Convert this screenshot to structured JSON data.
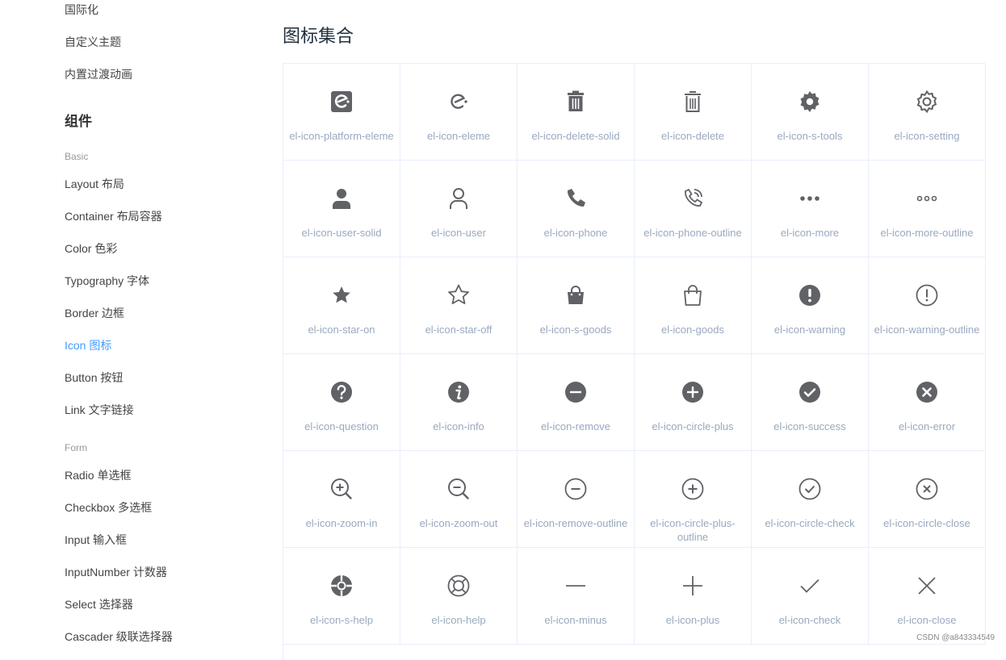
{
  "sidebar": {
    "top_items": [
      "国际化",
      "自定义主题",
      "内置过渡动画"
    ],
    "group_title": "组件",
    "basic": {
      "title": "Basic",
      "items": [
        "Layout 布局",
        "Container 布局容器",
        "Color 色彩",
        "Typography 字体",
        "Border 边框",
        "Icon 图标",
        "Button 按钮",
        "Link 文字链接"
      ]
    },
    "form": {
      "title": "Form",
      "items": [
        "Radio 单选框",
        "Checkbox 多选框",
        "Input 输入框",
        "InputNumber 计数器",
        "Select 选择器",
        "Cascader 级联选择器"
      ]
    },
    "active_item": "Icon 图标"
  },
  "main": {
    "title": "图标集合",
    "icons": [
      {
        "name": "el-icon-platform-eleme",
        "icon": "platform-eleme"
      },
      {
        "name": "el-icon-eleme",
        "icon": "eleme"
      },
      {
        "name": "el-icon-delete-solid",
        "icon": "delete-solid"
      },
      {
        "name": "el-icon-delete",
        "icon": "delete"
      },
      {
        "name": "el-icon-s-tools",
        "icon": "s-tools"
      },
      {
        "name": "el-icon-setting",
        "icon": "setting"
      },
      {
        "name": "el-icon-user-solid",
        "icon": "user-solid"
      },
      {
        "name": "el-icon-user",
        "icon": "user"
      },
      {
        "name": "el-icon-phone",
        "icon": "phone"
      },
      {
        "name": "el-icon-phone-outline",
        "icon": "phone-outline"
      },
      {
        "name": "el-icon-more",
        "icon": "more"
      },
      {
        "name": "el-icon-more-outline",
        "icon": "more-outline"
      },
      {
        "name": "el-icon-star-on",
        "icon": "star-on"
      },
      {
        "name": "el-icon-star-off",
        "icon": "star-off"
      },
      {
        "name": "el-icon-s-goods",
        "icon": "s-goods"
      },
      {
        "name": "el-icon-goods",
        "icon": "goods"
      },
      {
        "name": "el-icon-warning",
        "icon": "warning"
      },
      {
        "name": "el-icon-warning-outline",
        "icon": "warning-outline"
      },
      {
        "name": "el-icon-question",
        "icon": "question"
      },
      {
        "name": "el-icon-info",
        "icon": "info"
      },
      {
        "name": "el-icon-remove",
        "icon": "remove"
      },
      {
        "name": "el-icon-circle-plus",
        "icon": "circle-plus"
      },
      {
        "name": "el-icon-success",
        "icon": "success"
      },
      {
        "name": "el-icon-error",
        "icon": "error"
      },
      {
        "name": "el-icon-zoom-in",
        "icon": "zoom-in"
      },
      {
        "name": "el-icon-zoom-out",
        "icon": "zoom-out"
      },
      {
        "name": "el-icon-remove-outline",
        "icon": "remove-outline"
      },
      {
        "name": "el-icon-circle-plus-outline",
        "icon": "circle-plus-outline"
      },
      {
        "name": "el-icon-circle-check",
        "icon": "circle-check"
      },
      {
        "name": "el-icon-circle-close",
        "icon": "circle-close"
      },
      {
        "name": "el-icon-s-help",
        "icon": "s-help"
      },
      {
        "name": "el-icon-help",
        "icon": "help"
      },
      {
        "name": "el-icon-minus",
        "icon": "minus"
      },
      {
        "name": "el-icon-plus",
        "icon": "plus"
      },
      {
        "name": "el-icon-check",
        "icon": "check"
      },
      {
        "name": "el-icon-close",
        "icon": "close"
      }
    ]
  },
  "watermark": "CSDN @a843334549",
  "colors": {
    "icon": "#606266",
    "label": "#99a9bf",
    "active": "#409eff",
    "border": "#eaeefb"
  }
}
